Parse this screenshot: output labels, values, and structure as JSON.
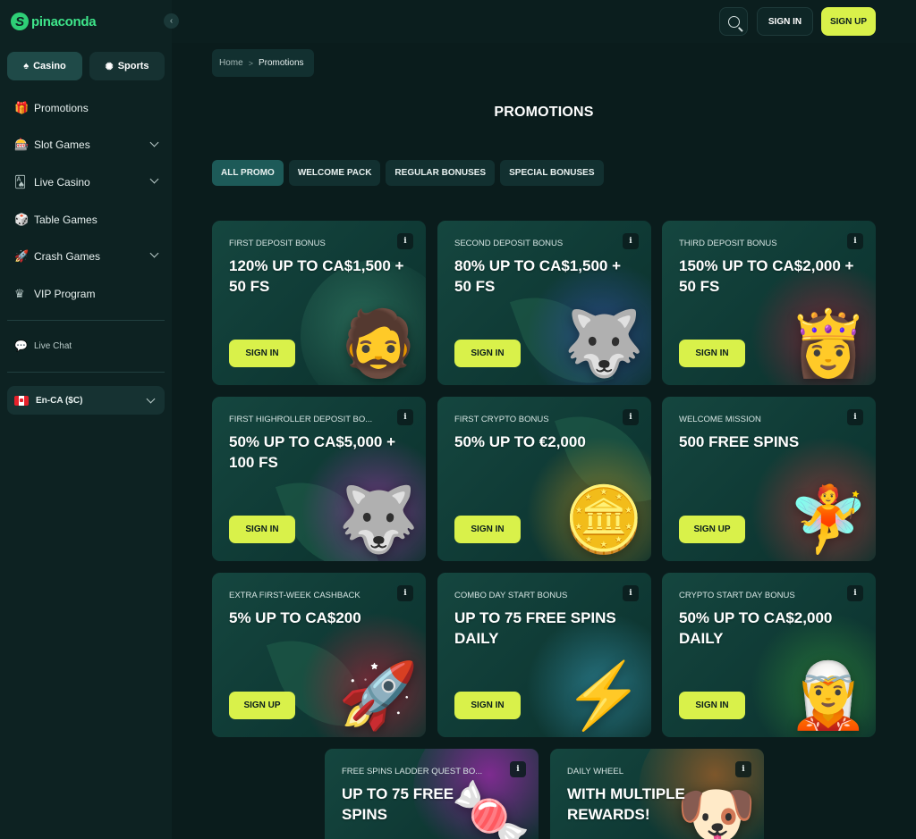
{
  "brand": {
    "name": "pinaconda",
    "mark": "S"
  },
  "sidebar": {
    "modes": [
      {
        "label": "Casino",
        "icon": "spade-icon"
      },
      {
        "label": "Sports",
        "icon": "ball-icon"
      }
    ],
    "items": [
      {
        "label": "Promotions",
        "icon": "gift-icon",
        "has_submenu": false
      },
      {
        "label": "Slot Games",
        "icon": "slot-icon",
        "has_submenu": true
      },
      {
        "label": "Live Casino",
        "icon": "cards-icon",
        "has_submenu": true
      },
      {
        "label": "Table Games",
        "icon": "dice-icon",
        "has_submenu": false
      },
      {
        "label": "Crash Games",
        "icon": "rocket-icon",
        "has_submenu": true
      },
      {
        "label": "VIP Program",
        "icon": "crown-icon",
        "has_submenu": false
      }
    ],
    "live_chat": "Live Chat",
    "language": "En-CA ($C)"
  },
  "header": {
    "sign_in": "SIGN IN",
    "sign_up": "SIGN UP"
  },
  "breadcrumb": {
    "home": "Home",
    "separator": ">",
    "current": "Promotions"
  },
  "page_title": "PROMOTIONS",
  "filters": [
    "ALL PROMO",
    "WELCOME PACK",
    "REGULAR BONUSES",
    "SPECIAL BONUSES"
  ],
  "colors": {
    "accent": "#d9f14a",
    "brand": "#2ecf76",
    "background": "#0a1c1c"
  },
  "promos": [
    {
      "label": "FIRST DEPOSIT BONUS",
      "headline": "120% UP TO CA$1,500 + 50 FS",
      "cta": "SIGN IN",
      "art": "🧔",
      "info": "i"
    },
    {
      "label": "SECOND DEPOSIT BONUS",
      "headline": "80% UP TO CA$1,500 + 50 FS",
      "cta": "SIGN IN",
      "art": "🐺",
      "info": "i"
    },
    {
      "label": "THIRD DEPOSIT BONUS",
      "headline": "150% UP TO CA$2,000 + 50 FS",
      "cta": "SIGN IN",
      "art": "👸",
      "info": "i"
    },
    {
      "label": "FIRST HIGHROLLER DEPOSIT BO...",
      "headline": "50% UP TO CA$5,000 + 100 FS",
      "cta": "SIGN IN",
      "art": "🐺",
      "info": "i"
    },
    {
      "label": "FIRST CRYPTO BONUS",
      "headline": "50% UP TO €2,000",
      "cta": "SIGN IN",
      "art": "🪙",
      "info": "i"
    },
    {
      "label": "WELCOME MISSION",
      "headline": "500 FREE SPINS",
      "cta": "SIGN UP",
      "art": "🧚",
      "info": "i"
    },
    {
      "label": "EXTRA FIRST-WEEK CASHBACK",
      "headline": "5% UP TO CA$200",
      "cta": "SIGN UP",
      "art": "🚀",
      "info": "i"
    },
    {
      "label": "COMBO DAY START BONUS",
      "headline": "UP TO 75 FREE SPINS DAILY",
      "cta": "SIGN IN",
      "art": "⚡",
      "info": "i"
    },
    {
      "label": "CRYPTO START DAY BONUS",
      "headline": "50% UP TO CA$2,000 DAILY",
      "cta": "SIGN IN",
      "art": "🧝",
      "info": "i"
    },
    {
      "label": "FREE SPINS LADDER QUEST BO...",
      "headline": "UP TO 75 FREE SPINS",
      "cta": "",
      "art": "🍬",
      "info": "i"
    },
    {
      "label": "DAILY WHEEL",
      "headline": "WITH MULTIPLE REWARDS!",
      "cta": "",
      "art": "🐶",
      "info": "i"
    }
  ]
}
